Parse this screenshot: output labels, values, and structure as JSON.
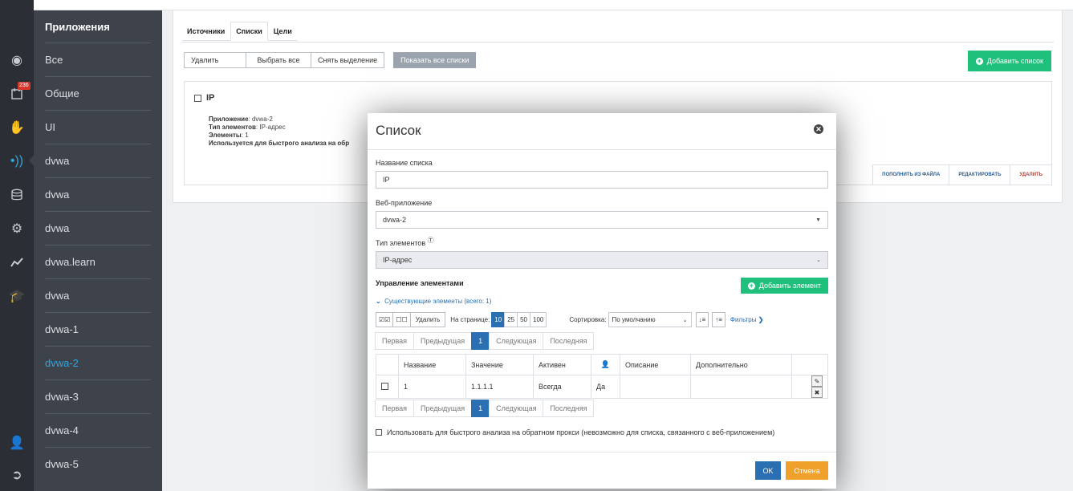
{
  "rail": {
    "badge": "236"
  },
  "apps": {
    "header": "Приложения",
    "items": [
      "Все",
      "Общие",
      "UI",
      "dvwa",
      "dvwa",
      "dvwa",
      "dvwa.learn",
      "dvwa",
      "dvwa-1",
      "dvwa-2",
      "dvwa-3",
      "dvwa-4",
      "dvwa-5"
    ],
    "active_index": 9
  },
  "tabs": [
    "Источники",
    "Списки",
    "Цели"
  ],
  "toolbar": {
    "delete": "Удалить",
    "select_all": "Выбрать все",
    "deselect": "Снять выделение",
    "show_all": "Показать все списки",
    "add_list": "Добавить список"
  },
  "card": {
    "title": "IP",
    "app_label": "Приложение",
    "app_value": ": dvwa-2",
    "type_label": "Тип элементов",
    "type_value": ": IP-адрес",
    "elements_label": "Элементы",
    "elements_value": ": 1",
    "quick_label": "Используется для быстрого анализа на обр",
    "actions": [
      "пополнить из файла",
      "редактировать",
      "удалить"
    ]
  },
  "modal": {
    "title": "Список",
    "name_label": "Название списка",
    "name_value": "IP",
    "app_label": "Веб-приложение",
    "app_value": "dvwa-2",
    "type_label": "Тип элементов",
    "type_value": "IP-адрес",
    "manage_title": "Управление элементами",
    "add_element": "Добавить элемент",
    "existing": "Существующие элементы (всего: 1)",
    "delete": "Удалить",
    "per_page_label": "На странице:",
    "per_page_options": [
      "10",
      "25",
      "50",
      "100"
    ],
    "sort_label": "Сортировка:",
    "sort_value": "По умолчанию",
    "filters": "Фильтры",
    "pager": {
      "first": "Первая",
      "prev": "Предыдущая",
      "current": "1",
      "next": "Следующая",
      "last": "Последняя"
    },
    "columns": [
      "Название",
      "Значение",
      "Активен",
      "Описание",
      "Дополнительно"
    ],
    "rows": [
      {
        "name": "1",
        "value": "1.1.1.1",
        "active": "Всегда",
        "user": "Да",
        "desc": "",
        "extra": ""
      }
    ],
    "quick_check": "Использовать для быстрого анализа на обратном прокси (невозможно для списка, связанного с веб-приложением)",
    "ok": "OK",
    "cancel": "Отмена"
  },
  "colors": {
    "accent": "#2fa6e0",
    "primary": "#2a6fb1",
    "success": "#1fbf7c",
    "warning": "#f0a12c"
  }
}
